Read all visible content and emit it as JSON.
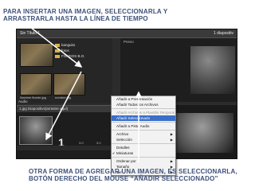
{
  "captions": {
    "top": "PARA INSERTAR UNA IMAGEN, SELECCIONARLA Y ARRASTRARLA HASTA LA LÍNEA DE TIEMPO",
    "bottom": "OTRA FORMA DE AGREGAR UNA IMAGEN, ES SELECCIONARLA, BOTÓN DERECHO DEL MOUSE “AÑADIR SELECCIONADO”"
  },
  "window": {
    "title": "Sin Título 1",
    "right_label": "1 diapositiv"
  },
  "library": {
    "folders": [
      "banguito",
      "fotos",
      "FONDOS B.O."
    ],
    "thumb_labels": [
      "Nombre fiuerte.jpg",
      "nombre.jpg"
    ]
  },
  "preview": {
    "label": "Previo"
  },
  "panel": {
    "audio_label": "Audio"
  },
  "timeline": {
    "header": "1.jpg Diapositivs(arrastre aquí)",
    "slide_number": "1",
    "duration": "3.0",
    "tick": "3.0"
  },
  "context_menu": {
    "items": [
      {
        "label": "Añadir a Presentación",
        "state": "normal",
        "arrow": false,
        "check": false
      },
      {
        "label": "Añadir Todos los Archivos",
        "state": "normal",
        "arrow": false,
        "check": false
      },
      {
        "sep": true
      },
      {
        "label": "Añadir Archivos a Plantilla Temporal",
        "state": "disabled",
        "arrow": false,
        "check": false
      },
      {
        "label": "Añadir Seleccionado",
        "state": "selected",
        "arrow": false,
        "check": false
      },
      {
        "sep": true
      },
      {
        "label": "Añadir a Pista Audio",
        "state": "normal",
        "arrow": false,
        "check": false
      },
      {
        "sep": true
      },
      {
        "label": "Archivo",
        "state": "normal",
        "arrow": true,
        "check": false
      },
      {
        "label": "Selección",
        "state": "normal",
        "arrow": true,
        "check": false
      },
      {
        "sep": true
      },
      {
        "label": "Detalles",
        "state": "normal",
        "arrow": false,
        "check": false
      },
      {
        "label": "Miniaturas",
        "state": "normal",
        "arrow": false,
        "check": true
      },
      {
        "sep": true
      },
      {
        "label": "Ordenar por",
        "state": "normal",
        "arrow": true,
        "check": false
      },
      {
        "label": "Tamaño",
        "state": "normal",
        "arrow": true,
        "check": false
      },
      {
        "label": "Ver",
        "state": "normal",
        "arrow": true,
        "check": false
      }
    ]
  },
  "colors": {
    "caption": "#3c5078",
    "menu_highlight": "#3a6fc9",
    "arrow": "#ffffff"
  }
}
